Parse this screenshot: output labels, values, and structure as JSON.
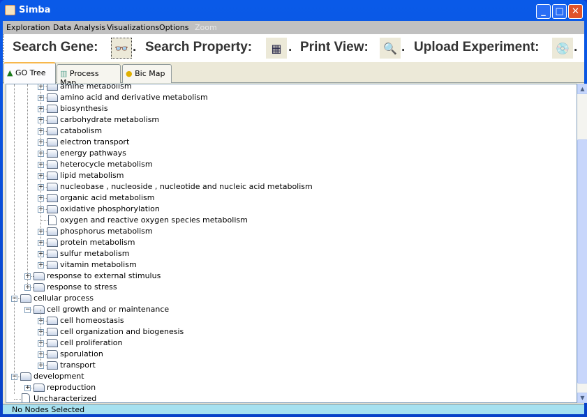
{
  "window": {
    "title": "Simba"
  },
  "menu": [
    "Exploration",
    "Data Analysis",
    "Visualizations",
    "Options",
    "Zoom"
  ],
  "toolbar": {
    "search_gene": "Search Gene:",
    "search_property": "Search Property:",
    "print_view": "Print View:",
    "upload_experiment": "Upload Experiment:",
    "sep": "."
  },
  "tabs": [
    {
      "label": "GO Tree",
      "icon": "tree-icon"
    },
    {
      "label": "Process Map",
      "icon": "map-icon"
    },
    {
      "label": "Bic Map",
      "icon": "bic-icon"
    }
  ],
  "tree": [
    {
      "label": "amine metabolism",
      "level": 2,
      "type": "folder",
      "state": "collapsed"
    },
    {
      "label": "amino acid and derivative metabolism",
      "level": 2,
      "type": "folder",
      "state": "collapsed"
    },
    {
      "label": "biosynthesis",
      "level": 2,
      "type": "folder",
      "state": "collapsed"
    },
    {
      "label": "carbohydrate metabolism",
      "level": 2,
      "type": "folder",
      "state": "collapsed"
    },
    {
      "label": "catabolism",
      "level": 2,
      "type": "folder",
      "state": "collapsed"
    },
    {
      "label": "electron transport",
      "level": 2,
      "type": "folder",
      "state": "collapsed"
    },
    {
      "label": "energy pathways",
      "level": 2,
      "type": "folder",
      "state": "collapsed"
    },
    {
      "label": "heterocycle metabolism",
      "level": 2,
      "type": "folder",
      "state": "collapsed"
    },
    {
      "label": "lipid metabolism",
      "level": 2,
      "type": "folder",
      "state": "collapsed"
    },
    {
      "label": "nucleobase , nucleoside , nucleotide and nucleic acid metabolism",
      "level": 2,
      "type": "folder",
      "state": "collapsed"
    },
    {
      "label": "organic acid metabolism",
      "level": 2,
      "type": "folder",
      "state": "collapsed"
    },
    {
      "label": "oxidative phosphorylation",
      "level": 2,
      "type": "folder",
      "state": "collapsed"
    },
    {
      "label": "oxygen and reactive oxygen species metabolism",
      "level": 2,
      "type": "leaf",
      "state": "leaf"
    },
    {
      "label": "phosphorus metabolism",
      "level": 2,
      "type": "folder",
      "state": "collapsed"
    },
    {
      "label": "protein metabolism",
      "level": 2,
      "type": "folder",
      "state": "collapsed"
    },
    {
      "label": "sulfur metabolism",
      "level": 2,
      "type": "folder",
      "state": "collapsed"
    },
    {
      "label": "vitamin metabolism",
      "level": 2,
      "type": "folder",
      "state": "collapsed"
    },
    {
      "label": "response to external stimulus",
      "level": 1,
      "type": "folder",
      "state": "collapsed"
    },
    {
      "label": "response to stress",
      "level": 1,
      "type": "folder",
      "state": "collapsed"
    },
    {
      "label": "cellular process",
      "level": 0,
      "type": "folder",
      "state": "expanded"
    },
    {
      "label": "cell growth and or maintenance",
      "level": 1,
      "type": "folder",
      "state": "expanded"
    },
    {
      "label": "cell homeostasis",
      "level": 2,
      "type": "folder",
      "state": "collapsed"
    },
    {
      "label": "cell organization and biogenesis",
      "level": 2,
      "type": "folder",
      "state": "collapsed"
    },
    {
      "label": "cell proliferation",
      "level": 2,
      "type": "folder",
      "state": "collapsed"
    },
    {
      "label": "sporulation",
      "level": 2,
      "type": "folder",
      "state": "collapsed"
    },
    {
      "label": "transport",
      "level": 2,
      "type": "folder",
      "state": "collapsed"
    },
    {
      "label": "development",
      "level": 0,
      "type": "folder",
      "state": "expanded"
    },
    {
      "label": "reproduction",
      "level": 1,
      "type": "folder",
      "state": "collapsed"
    },
    {
      "label": "Uncharacterized",
      "level": 0,
      "type": "leaf",
      "state": "leaf"
    }
  ],
  "status": "No Nodes Selected"
}
